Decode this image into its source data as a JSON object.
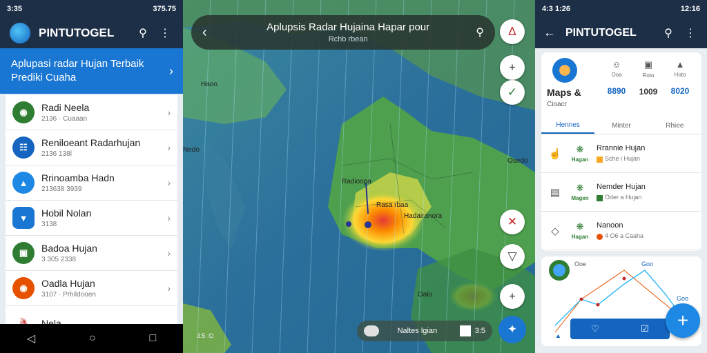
{
  "left": {
    "status": {
      "time": "3:35",
      "right": "375.75"
    },
    "app_title": "PINTUTOGEL",
    "icons": {
      "search": "search-icon",
      "menu": "more-vert-icon"
    },
    "banner": {
      "line1": "Aplupasi radar Hujan Terbaik",
      "line2": "Prediki Cuaha"
    },
    "items": [
      {
        "title": "Radi Neela",
        "sub": "2136 · Cuaaan",
        "color": "#2e7d32"
      },
      {
        "title": "Reniloeant Radarhujan",
        "sub": "2136 138l",
        "color": "#1565c0"
      },
      {
        "title": "Rrinoamba Hadn",
        "sub": "213638 3939",
        "color": "#1e88e5"
      },
      {
        "title": "Hobil Nolan",
        "sub": "3138",
        "color": "#1976d2"
      },
      {
        "title": "Badoa Hujan",
        "sub": "3 305 2338",
        "color": "#2e7d32"
      },
      {
        "title": "Oadla Hujan",
        "sub": "3107 · Prhildooen",
        "color": "#e65100"
      },
      {
        "title": "Nela",
        "sub": "",
        "color": "#ffffff"
      }
    ]
  },
  "mid": {
    "title": "Aplupsis Radar Hujaina Hapar pour",
    "subtitle": "Rchb rbean",
    "labels": {
      "a": "Haoo",
      "b": "Nedo",
      "c": "Radioopa",
      "d": "Osedo",
      "e": "Rasa rbaa",
      "f": "Hadairanora",
      "g": "Oalo"
    },
    "legend_text": "Naltes lgian",
    "legend_time": "3:5",
    "coord": "3:5 :O"
  },
  "right": {
    "status": {
      "time": "4:3 1:26",
      "right": "12:16"
    },
    "app_title": "PINTUTOGEL",
    "app_name": "Maps &",
    "app_sub": "Cioacr",
    "stats": [
      {
        "label": "Ooa",
        "value": "8890",
        "color": "#1565c0"
      },
      {
        "label": "Roto",
        "value": "1009",
        "color": "#333333"
      },
      {
        "label": "Hoto",
        "value": "8020",
        "color": "#1565c0"
      }
    ],
    "tabs": [
      "Hennes",
      "Minter",
      "Rhiee"
    ],
    "rows": [
      {
        "title": "Rrannie Hujan",
        "tag": "Hagan",
        "sub": "Sche i Hujan",
        "sq": "#f9a825"
      },
      {
        "title": "Nemder Hujan",
        "tag": "Magen",
        "sub": "Oder a Hujan",
        "sq": "#2e7d32"
      },
      {
        "title": "Nanoon",
        "tag": "Hagan",
        "sub": "4 O6 a Caaha",
        "sq": "#e65100"
      }
    ],
    "chart_card": {
      "label": "Ooe",
      "val1": "Goo",
      "val2": "Goo"
    }
  }
}
